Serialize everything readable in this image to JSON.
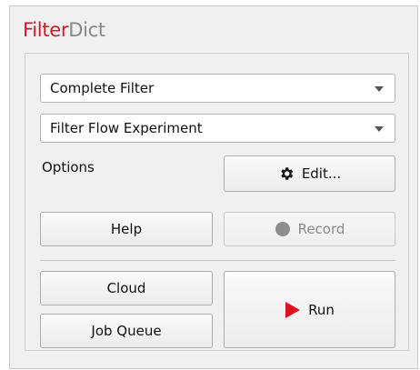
{
  "title": {
    "part1": "Filter",
    "part2": "Dict"
  },
  "filter_select": {
    "value": "Complete Filter"
  },
  "experiment_select": {
    "value": "Filter Flow Experiment"
  },
  "options_label": "Options",
  "buttons": {
    "edit": "Edit...",
    "help": "Help",
    "record": "Record",
    "cloud": "Cloud",
    "job_queue": "Job Queue",
    "run": "Run"
  },
  "icons": {
    "edit": "gear-icon",
    "record": "record-dot-icon",
    "run": "play-icon",
    "dropdown": "chevron-down-icon"
  },
  "colors": {
    "brand_red": "#d5192a",
    "brand_gray": "#888888",
    "run_red": "#e01020"
  }
}
